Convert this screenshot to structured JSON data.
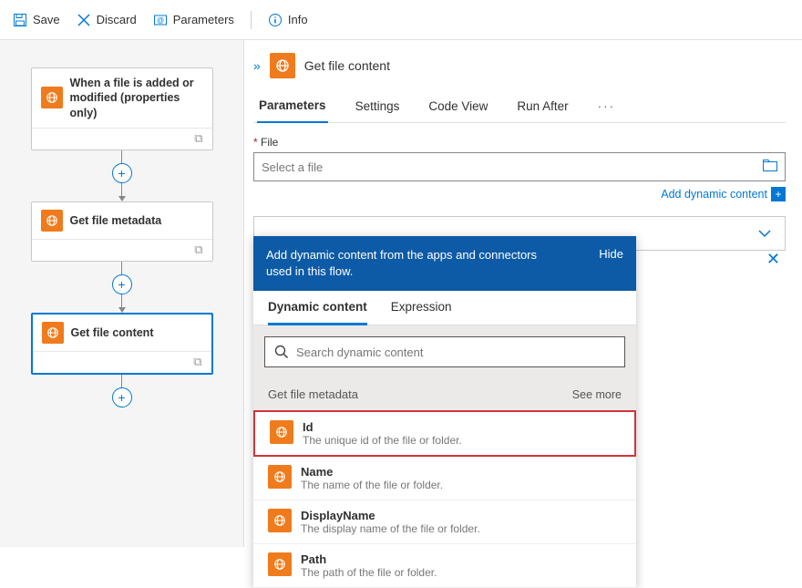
{
  "toolbar": {
    "save": "Save",
    "discard": "Discard",
    "parameters": "Parameters",
    "info": "Info"
  },
  "canvas": {
    "cards": [
      {
        "title": "When a file is added or modified (properties only)"
      },
      {
        "title": "Get file metadata"
      },
      {
        "title": "Get file content"
      }
    ]
  },
  "panel": {
    "title": "Get file content",
    "tabs": {
      "parameters": "Parameters",
      "settings": "Settings",
      "codeview": "Code View",
      "runafter": "Run After"
    },
    "fileLabel": "File",
    "filePlaceholder": "Select a file",
    "addDynamic": "Add dynamic content"
  },
  "popover": {
    "banner": "Add dynamic content from the apps and connectors used in this flow.",
    "hide": "Hide",
    "tabs": {
      "dynamic": "Dynamic content",
      "expression": "Expression"
    },
    "searchPlaceholder": "Search dynamic content",
    "sectionTitle": "Get file metadata",
    "seeMore": "See more",
    "items": [
      {
        "title": "Id",
        "desc": "The unique id of the file or folder."
      },
      {
        "title": "Name",
        "desc": "The name of the file or folder."
      },
      {
        "title": "DisplayName",
        "desc": "The display name of the file or folder."
      },
      {
        "title": "Path",
        "desc": "The path of the file or folder."
      }
    ]
  }
}
